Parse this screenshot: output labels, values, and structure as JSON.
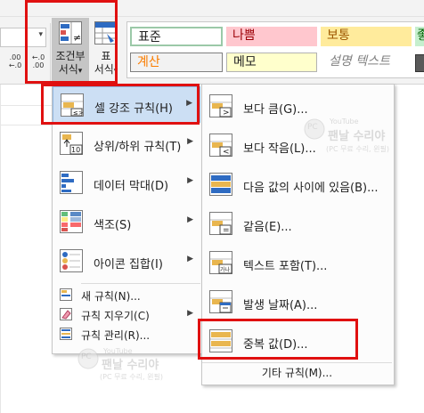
{
  "ribbon": {
    "number_buttons": [
      {
        "label": ".00 ←.0"
      },
      {
        "label": "←.0 .00"
      }
    ],
    "conditional_formatting": {
      "line1": "조건부",
      "line2": "서식",
      "caret": "▾"
    },
    "format_as_table": {
      "line1": "표",
      "line2": "서식",
      "caret": "▾"
    },
    "cell_styles": [
      {
        "label": "표준",
        "bg": "#ffffff",
        "border": "#9bc9a8",
        "color": "#222222"
      },
      {
        "label": "나쁨",
        "bg": "#ffc7ce",
        "border": "#ffc7ce",
        "color": "#9c0006"
      },
      {
        "label": "보통",
        "bg": "#ffeb9c",
        "border": "#ffeb9c",
        "color": "#9c5700"
      },
      {
        "label": "좋",
        "bg": "#c6efce",
        "border": "#c6efce",
        "color": "#006100"
      },
      {
        "label": "계산",
        "bg": "#f2f2f2",
        "border": "#7f7f7f",
        "color": "#fa7d00"
      },
      {
        "label": "메모",
        "bg": "#ffffcc",
        "border": "#b2b2b2",
        "color": "#222222"
      },
      {
        "label": "설명 텍스트",
        "bg": "#ffffff",
        "border": "#ffffff",
        "color": "#7f7f7f"
      }
    ]
  },
  "main_menu": {
    "items": [
      {
        "label": "셀 강조 규칙(H)",
        "icon": "highlight-rules-icon"
      },
      {
        "label": "상위/하위 규칙(T)",
        "icon": "top-bottom-rules-icon"
      },
      {
        "label": "데이터 막대(D)",
        "icon": "data-bars-icon"
      },
      {
        "label": "색조(S)",
        "icon": "color-scales-icon"
      },
      {
        "label": "아이콘 집합(I)",
        "icon": "icon-sets-icon"
      }
    ],
    "small_items": [
      {
        "label": "새 규칙(N)...",
        "icon": "new-rule-icon"
      },
      {
        "label": "규칙 지우기(C)",
        "icon": "clear-rules-icon"
      },
      {
        "label": "규칙 관리(R)...",
        "icon": "manage-rules-icon"
      }
    ],
    "submenu_arrow": "▶"
  },
  "submenu": {
    "items": [
      {
        "label": "보다 큼(G)...",
        "icon": "greater-than-icon"
      },
      {
        "label": "보다 작음(L)...",
        "icon": "less-than-icon"
      },
      {
        "label": "다음 값의 사이에 있음(B)...",
        "icon": "between-icon"
      },
      {
        "label": "같음(E)...",
        "icon": "equal-to-icon"
      },
      {
        "label": "텍스트 포함(T)...",
        "icon": "text-contains-icon"
      },
      {
        "label": "발생 날짜(A)...",
        "icon": "date-occurring-icon"
      },
      {
        "label": "중복 값(D)...",
        "icon": "duplicate-values-icon"
      }
    ],
    "more_rules": "기타 규칙(M)..."
  },
  "watermark": {
    "channel": "YouTube",
    "brand": "팬날 수리야",
    "tag": "(PC 무료 수리, 윈필)",
    "pc": "PC"
  },
  "colors": {
    "accent_red": "#e01010",
    "highlight": "#ccdff4",
    "icon_blue": "#2e6bc2",
    "icon_orange": "#e9b64f"
  }
}
